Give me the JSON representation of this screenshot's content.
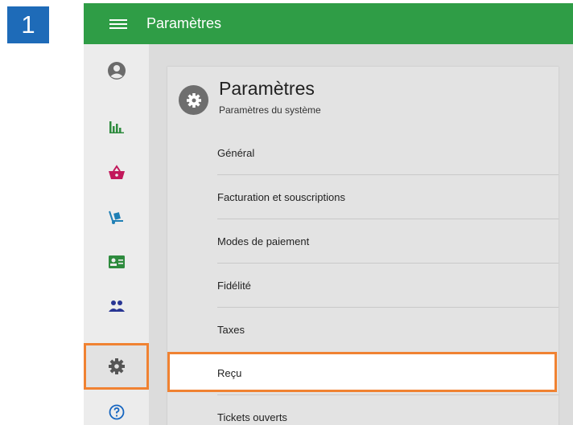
{
  "step": {
    "number": "1"
  },
  "topbar": {
    "title": "Paramètres"
  },
  "sidebar": {
    "items": [
      {
        "name": "account",
        "icon": "account-circle-icon"
      },
      {
        "name": "reports",
        "icon": "bar-chart-icon"
      },
      {
        "name": "sales",
        "icon": "basket-icon"
      },
      {
        "name": "items",
        "icon": "dolly-icon"
      },
      {
        "name": "employees",
        "icon": "id-card-icon"
      },
      {
        "name": "customers",
        "icon": "people-icon"
      },
      {
        "name": "settings",
        "icon": "gear-icon",
        "selected": true
      },
      {
        "name": "help",
        "icon": "help-circle-icon"
      }
    ]
  },
  "card": {
    "title": "Paramètres",
    "subtitle": "Paramètres du système",
    "items": [
      {
        "label": "Général"
      },
      {
        "label": "Facturation et souscriptions"
      },
      {
        "label": "Modes de paiement"
      },
      {
        "label": "Fidélité"
      },
      {
        "label": "Taxes"
      },
      {
        "label": "Reçu",
        "selected": true
      },
      {
        "label": "Tickets ouverts"
      }
    ]
  },
  "colors": {
    "topbar": "#2f9d46",
    "highlight": "#f08232",
    "badge": "#1e6bb8"
  }
}
